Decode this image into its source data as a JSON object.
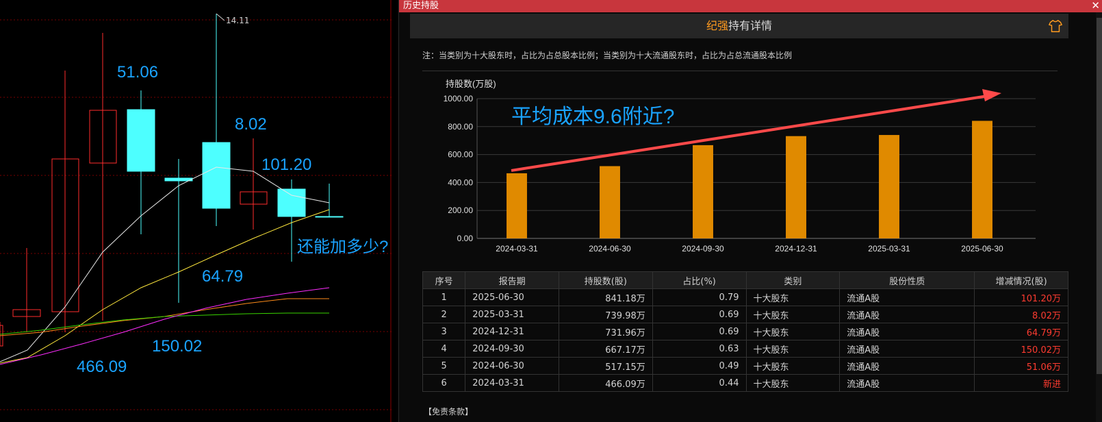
{
  "kline": {
    "high_label": "14.11",
    "annotations": [
      {
        "text": "51.06"
      },
      {
        "text": "8.02"
      },
      {
        "text": "101.20"
      },
      {
        "text": "还能加多少?"
      },
      {
        "text": "64.79"
      },
      {
        "text": "150.02"
      },
      {
        "text": "466.09"
      }
    ]
  },
  "panel": {
    "window_title": "历史持股",
    "close_glyph": "✕",
    "holder_name": "纪强",
    "header_suffix": "持有详情",
    "note": "注：当类别为十大股东时，占比为占总股本比例；当类别为十大流通股东时，占比为占总流通股本比例",
    "disclaimer": "【免责条款】"
  },
  "chart_data": {
    "type": "bar",
    "ylabel": "持股数(万股)",
    "annotation": "平均成本9.6附近?",
    "categories": [
      "2024-03-31",
      "2024-06-30",
      "2024-09-30",
      "2024-12-31",
      "2025-03-31",
      "2025-06-30"
    ],
    "values": [
      466.09,
      517.15,
      667.17,
      731.96,
      739.98,
      841.18
    ],
    "ylim": [
      0,
      1000
    ],
    "yticks": [
      "0.00",
      "200.00",
      "400.00",
      "600.00",
      "800.00",
      "1000.00"
    ],
    "bar_color": "#e08a00",
    "arrow_color": "#ff4a4a",
    "grid": true
  },
  "table": {
    "headers": [
      "序号",
      "报告期",
      "持股数(股)",
      "占比(%)",
      "类别",
      "股份性质",
      "增减情况(股)"
    ],
    "rows": [
      [
        "1",
        "2025-06-30",
        "841.18万",
        "0.79",
        "十大股东",
        "流通A股",
        "101.20万"
      ],
      [
        "2",
        "2025-03-31",
        "739.98万",
        "0.69",
        "十大股东",
        "流通A股",
        "8.02万"
      ],
      [
        "3",
        "2024-12-31",
        "731.96万",
        "0.69",
        "十大股东",
        "流通A股",
        "64.79万"
      ],
      [
        "4",
        "2024-09-30",
        "667.17万",
        "0.63",
        "十大股东",
        "流通A股",
        "150.02万"
      ],
      [
        "5",
        "2024-06-30",
        "517.15万",
        "0.49",
        "十大股东",
        "流通A股",
        "51.06万"
      ],
      [
        "6",
        "2024-03-31",
        "466.09万",
        "0.44",
        "十大股东",
        "流通A股",
        "新进"
      ]
    ]
  }
}
